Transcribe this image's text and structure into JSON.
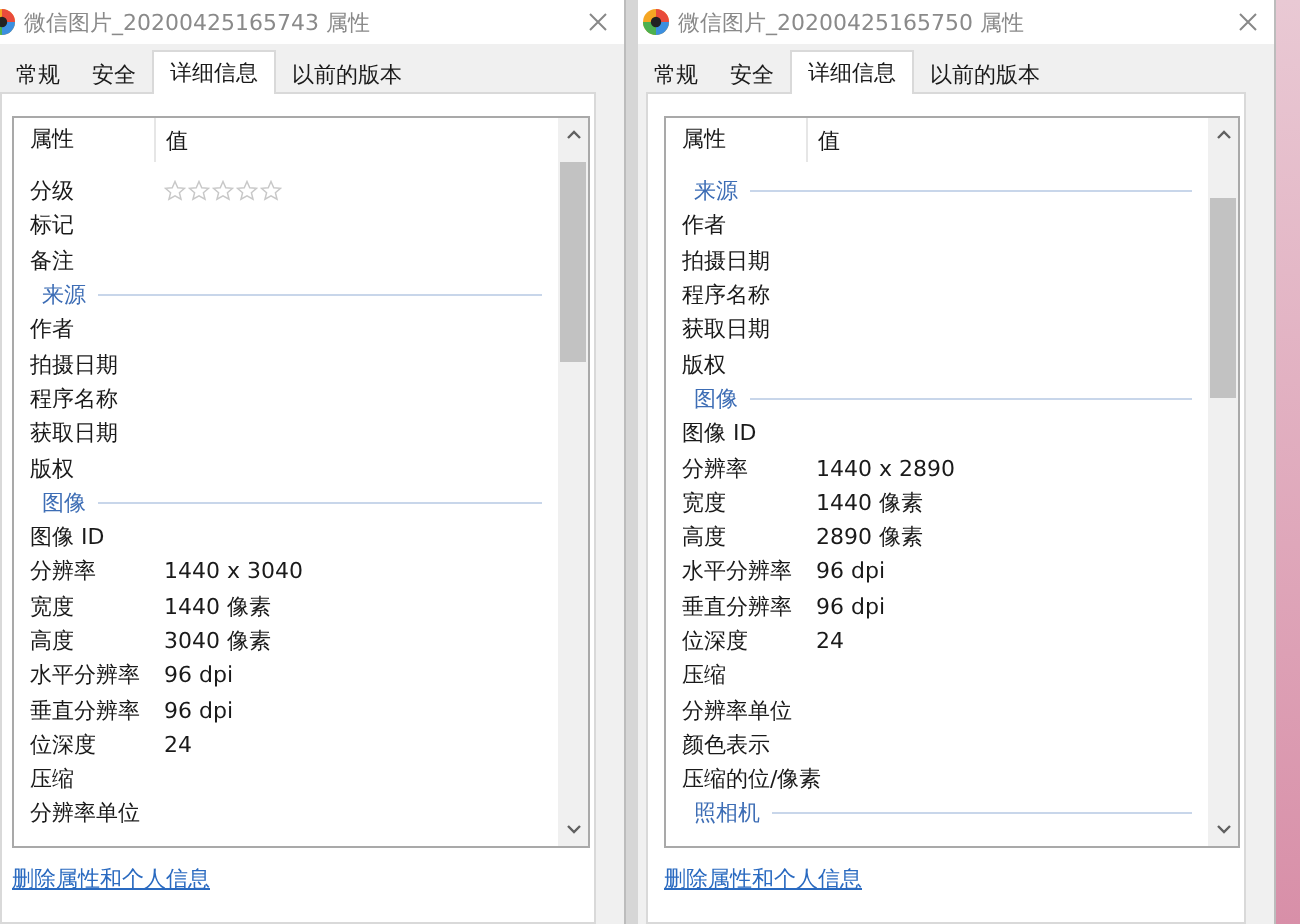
{
  "dialogs": [
    {
      "title": "微信图片_20200425165743 属性",
      "tabs": [
        {
          "label": "常规",
          "selected": false
        },
        {
          "label": "安全",
          "selected": false
        },
        {
          "label": "详细信息",
          "selected": true
        },
        {
          "label": "以前的版本",
          "selected": false
        }
      ],
      "columns": [
        "属性",
        "值"
      ],
      "items": [
        {
          "kind": "stars",
          "name": "分级",
          "stars": 0
        },
        {
          "kind": "row",
          "name": "标记"
        },
        {
          "kind": "row",
          "name": "备注"
        },
        {
          "kind": "section",
          "name": "来源"
        },
        {
          "kind": "row",
          "name": "作者"
        },
        {
          "kind": "row",
          "name": "拍摄日期"
        },
        {
          "kind": "row",
          "name": "程序名称"
        },
        {
          "kind": "row",
          "name": "获取日期"
        },
        {
          "kind": "row",
          "name": "版权"
        },
        {
          "kind": "section",
          "name": "图像"
        },
        {
          "kind": "row",
          "name": "图像 ID"
        },
        {
          "kind": "row",
          "name": "分辨率",
          "value": "1440 x 3040"
        },
        {
          "kind": "row",
          "name": "宽度",
          "value": "1440 像素"
        },
        {
          "kind": "row",
          "name": "高度",
          "value": "3040 像素"
        },
        {
          "kind": "row",
          "name": "水平分辨率",
          "value": "96 dpi"
        },
        {
          "kind": "row",
          "name": "垂直分辨率",
          "value": "96 dpi"
        },
        {
          "kind": "row",
          "name": "位深度",
          "value": "24"
        },
        {
          "kind": "row",
          "name": "压缩"
        },
        {
          "kind": "row",
          "name": "分辨率单位"
        }
      ],
      "link": "删除属性和个人信息"
    },
    {
      "title": "微信图片_20200425165750 属性",
      "tabs": [
        {
          "label": "常规",
          "selected": false
        },
        {
          "label": "安全",
          "selected": false
        },
        {
          "label": "详细信息",
          "selected": true
        },
        {
          "label": "以前的版本",
          "selected": false
        }
      ],
      "columns": [
        "属性",
        "值"
      ],
      "items": [
        {
          "kind": "section",
          "name": "来源"
        },
        {
          "kind": "row",
          "name": "作者"
        },
        {
          "kind": "row",
          "name": "拍摄日期"
        },
        {
          "kind": "row",
          "name": "程序名称"
        },
        {
          "kind": "row",
          "name": "获取日期"
        },
        {
          "kind": "row",
          "name": "版权"
        },
        {
          "kind": "section",
          "name": "图像"
        },
        {
          "kind": "row",
          "name": "图像 ID"
        },
        {
          "kind": "row",
          "name": "分辨率",
          "value": "1440 x 2890"
        },
        {
          "kind": "row",
          "name": "宽度",
          "value": "1440 像素"
        },
        {
          "kind": "row",
          "name": "高度",
          "value": "2890 像素"
        },
        {
          "kind": "row",
          "name": "水平分辨率",
          "value": "96 dpi"
        },
        {
          "kind": "row",
          "name": "垂直分辨率",
          "value": "96 dpi"
        },
        {
          "kind": "row",
          "name": "位深度",
          "value": "24"
        },
        {
          "kind": "row",
          "name": "压缩"
        },
        {
          "kind": "row",
          "name": "分辨率单位"
        },
        {
          "kind": "row",
          "name": "颜色表示"
        },
        {
          "kind": "row",
          "name": "压缩的位/像素"
        },
        {
          "kind": "section",
          "name": "照相机"
        }
      ],
      "link": "删除属性和个人信息"
    }
  ]
}
